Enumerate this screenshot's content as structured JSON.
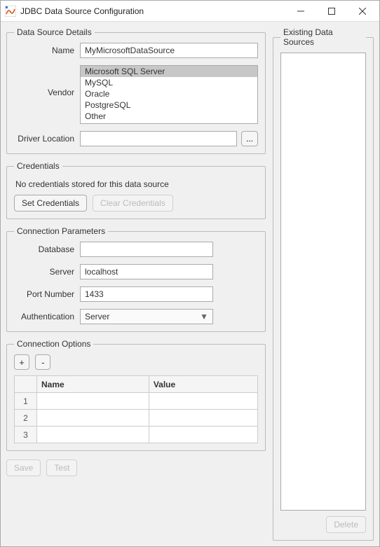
{
  "window": {
    "title": "JDBC Data Source Configuration"
  },
  "details": {
    "legend": "Data Source Details",
    "name_label": "Name",
    "name_value": "MyMicrosoftDataSource",
    "vendor_label": "Vendor",
    "vendors": [
      "Microsoft SQL Server",
      "MySQL",
      "Oracle",
      "PostgreSQL",
      "Other"
    ],
    "vendor_selected": "Microsoft SQL Server",
    "driver_label": "Driver Location",
    "driver_value": "",
    "browse": "..."
  },
  "credentials": {
    "legend": "Credentials",
    "message": "No credentials stored for this data source",
    "set_label": "Set Credentials",
    "clear_label": "Clear Credentials"
  },
  "params": {
    "legend": "Connection Parameters",
    "database_label": "Database",
    "database_value": "",
    "server_label": "Server",
    "server_value": "localhost",
    "port_label": "Port Number",
    "port_value": "1433",
    "auth_label": "Authentication",
    "auth_value": "Server"
  },
  "options": {
    "legend": "Connection Options",
    "add": "+",
    "remove": "-",
    "columns": {
      "name": "Name",
      "value": "Value"
    },
    "rows": [
      {
        "idx": "1",
        "name": "",
        "value": ""
      },
      {
        "idx": "2",
        "name": "",
        "value": ""
      },
      {
        "idx": "3",
        "name": "",
        "value": ""
      }
    ]
  },
  "existing": {
    "legend": "Existing Data Sources",
    "delete_label": "Delete"
  },
  "bottom": {
    "save": "Save",
    "test": "Test"
  }
}
